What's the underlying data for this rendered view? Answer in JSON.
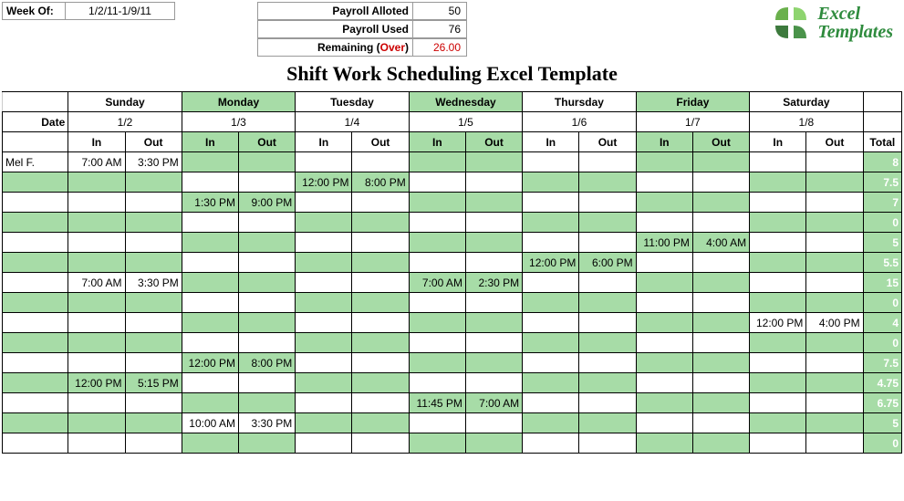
{
  "header": {
    "week_label": "Week Of:",
    "week_value": "1/2/11-1/9/11",
    "payroll": [
      {
        "label": "Payroll Alloted",
        "value": "50",
        "over": false
      },
      {
        "label": "Payroll Used",
        "value": "76",
        "over": false
      },
      {
        "label": "Remaining (Over)",
        "value": "26.00",
        "over": true
      }
    ],
    "logo_line1": "Excel",
    "logo_line2": "Templates"
  },
  "title": "Shift Work Scheduling Excel Template",
  "days": [
    "Sunday",
    "Monday",
    "Tuesday",
    "Wednesday",
    "Thursday",
    "Friday",
    "Saturday"
  ],
  "green_days": [
    false,
    true,
    false,
    true,
    false,
    true,
    false
  ],
  "date_label": "Date",
  "dates": [
    "1/2",
    "1/3",
    "1/4",
    "1/5",
    "1/6",
    "1/7",
    "1/8"
  ],
  "in_label": "In",
  "out_label": "Out",
  "total_label": "Total",
  "rows": [
    {
      "name": "Mel F.",
      "cells": [
        "7:00 AM",
        "3:30 PM",
        "",
        "",
        "",
        "",
        "",
        "",
        "",
        "",
        "",
        "",
        "",
        ""
      ],
      "total": "8"
    },
    {
      "name": "",
      "cells": [
        "",
        "",
        "",
        "",
        "12:00 PM",
        "8:00 PM",
        "",
        "",
        "",
        "",
        "",
        "",
        "",
        ""
      ],
      "total": "7.5"
    },
    {
      "name": "",
      "cells": [
        "",
        "",
        "1:30 PM",
        "9:00 PM",
        "",
        "",
        "",
        "",
        "",
        "",
        "",
        "",
        "",
        ""
      ],
      "total": "7"
    },
    {
      "name": "",
      "cells": [
        "",
        "",
        "",
        "",
        "",
        "",
        "",
        "",
        "",
        "",
        "",
        "",
        "",
        ""
      ],
      "total": "0"
    },
    {
      "name": "",
      "cells": [
        "",
        "",
        "",
        "",
        "",
        "",
        "",
        "",
        "",
        "",
        "11:00 PM",
        "4:00 AM",
        "",
        ""
      ],
      "total": "5"
    },
    {
      "name": "",
      "cells": [
        "",
        "",
        "",
        "",
        "",
        "",
        "",
        "",
        "12:00 PM",
        "6:00 PM",
        "",
        "",
        "",
        ""
      ],
      "total": "5.5"
    },
    {
      "name": "",
      "cells": [
        "7:00 AM",
        "3:30 PM",
        "",
        "",
        "",
        "",
        "7:00 AM",
        "2:30 PM",
        "",
        "",
        "",
        "",
        "",
        ""
      ],
      "total": "15"
    },
    {
      "name": "",
      "cells": [
        "",
        "",
        "",
        "",
        "",
        "",
        "",
        "",
        "",
        "",
        "",
        "",
        "",
        ""
      ],
      "total": "0"
    },
    {
      "name": "",
      "cells": [
        "",
        "",
        "",
        "",
        "",
        "",
        "",
        "",
        "",
        "",
        "",
        "",
        "12:00 PM",
        "4:00 PM"
      ],
      "total": "4"
    },
    {
      "name": "",
      "cells": [
        "",
        "",
        "",
        "",
        "",
        "",
        "",
        "",
        "",
        "",
        "",
        "",
        "",
        ""
      ],
      "total": "0"
    },
    {
      "name": "",
      "cells": [
        "",
        "",
        "12:00 PM",
        "8:00 PM",
        "",
        "",
        "",
        "",
        "",
        "",
        "",
        "",
        "",
        ""
      ],
      "total": "7.5"
    },
    {
      "name": "",
      "cells": [
        "12:00 PM",
        "5:15 PM",
        "",
        "",
        "",
        "",
        "",
        "",
        "",
        "",
        "",
        "",
        "",
        ""
      ],
      "total": "4.75"
    },
    {
      "name": "",
      "cells": [
        "",
        "",
        "",
        "",
        "",
        "",
        "11:45 PM",
        "7:00 AM",
        "",
        "",
        "",
        "",
        "",
        ""
      ],
      "total": "6.75"
    },
    {
      "name": "",
      "cells": [
        "",
        "",
        "10:00 AM",
        "3:30 PM",
        "",
        "",
        "",
        "",
        "",
        "",
        "",
        "",
        "",
        ""
      ],
      "total": "5"
    },
    {
      "name": "",
      "cells": [
        "",
        "",
        "",
        "",
        "",
        "",
        "",
        "",
        "",
        "",
        "",
        "",
        "",
        ""
      ],
      "total": "0"
    }
  ]
}
